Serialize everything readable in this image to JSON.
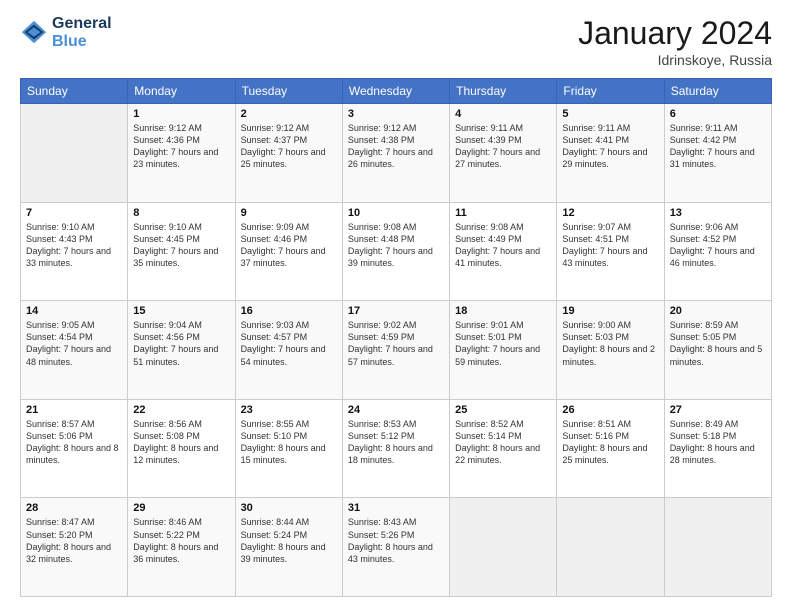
{
  "header": {
    "logo_line1": "General",
    "logo_line2": "Blue",
    "month_title": "January 2024",
    "location": "Idrinskoye, Russia"
  },
  "days_of_week": [
    "Sunday",
    "Monday",
    "Tuesday",
    "Wednesday",
    "Thursday",
    "Friday",
    "Saturday"
  ],
  "weeks": [
    [
      {
        "day": "",
        "sunrise": "",
        "sunset": "",
        "daylight": ""
      },
      {
        "day": "1",
        "sunrise": "Sunrise: 9:12 AM",
        "sunset": "Sunset: 4:36 PM",
        "daylight": "Daylight: 7 hours and 23 minutes."
      },
      {
        "day": "2",
        "sunrise": "Sunrise: 9:12 AM",
        "sunset": "Sunset: 4:37 PM",
        "daylight": "Daylight: 7 hours and 25 minutes."
      },
      {
        "day": "3",
        "sunrise": "Sunrise: 9:12 AM",
        "sunset": "Sunset: 4:38 PM",
        "daylight": "Daylight: 7 hours and 26 minutes."
      },
      {
        "day": "4",
        "sunrise": "Sunrise: 9:11 AM",
        "sunset": "Sunset: 4:39 PM",
        "daylight": "Daylight: 7 hours and 27 minutes."
      },
      {
        "day": "5",
        "sunrise": "Sunrise: 9:11 AM",
        "sunset": "Sunset: 4:41 PM",
        "daylight": "Daylight: 7 hours and 29 minutes."
      },
      {
        "day": "6",
        "sunrise": "Sunrise: 9:11 AM",
        "sunset": "Sunset: 4:42 PM",
        "daylight": "Daylight: 7 hours and 31 minutes."
      }
    ],
    [
      {
        "day": "7",
        "sunrise": "Sunrise: 9:10 AM",
        "sunset": "Sunset: 4:43 PM",
        "daylight": "Daylight: 7 hours and 33 minutes."
      },
      {
        "day": "8",
        "sunrise": "Sunrise: 9:10 AM",
        "sunset": "Sunset: 4:45 PM",
        "daylight": "Daylight: 7 hours and 35 minutes."
      },
      {
        "day": "9",
        "sunrise": "Sunrise: 9:09 AM",
        "sunset": "Sunset: 4:46 PM",
        "daylight": "Daylight: 7 hours and 37 minutes."
      },
      {
        "day": "10",
        "sunrise": "Sunrise: 9:08 AM",
        "sunset": "Sunset: 4:48 PM",
        "daylight": "Daylight: 7 hours and 39 minutes."
      },
      {
        "day": "11",
        "sunrise": "Sunrise: 9:08 AM",
        "sunset": "Sunset: 4:49 PM",
        "daylight": "Daylight: 7 hours and 41 minutes."
      },
      {
        "day": "12",
        "sunrise": "Sunrise: 9:07 AM",
        "sunset": "Sunset: 4:51 PM",
        "daylight": "Daylight: 7 hours and 43 minutes."
      },
      {
        "day": "13",
        "sunrise": "Sunrise: 9:06 AM",
        "sunset": "Sunset: 4:52 PM",
        "daylight": "Daylight: 7 hours and 46 minutes."
      }
    ],
    [
      {
        "day": "14",
        "sunrise": "Sunrise: 9:05 AM",
        "sunset": "Sunset: 4:54 PM",
        "daylight": "Daylight: 7 hours and 48 minutes."
      },
      {
        "day": "15",
        "sunrise": "Sunrise: 9:04 AM",
        "sunset": "Sunset: 4:56 PM",
        "daylight": "Daylight: 7 hours and 51 minutes."
      },
      {
        "day": "16",
        "sunrise": "Sunrise: 9:03 AM",
        "sunset": "Sunset: 4:57 PM",
        "daylight": "Daylight: 7 hours and 54 minutes."
      },
      {
        "day": "17",
        "sunrise": "Sunrise: 9:02 AM",
        "sunset": "Sunset: 4:59 PM",
        "daylight": "Daylight: 7 hours and 57 minutes."
      },
      {
        "day": "18",
        "sunrise": "Sunrise: 9:01 AM",
        "sunset": "Sunset: 5:01 PM",
        "daylight": "Daylight: 7 hours and 59 minutes."
      },
      {
        "day": "19",
        "sunrise": "Sunrise: 9:00 AM",
        "sunset": "Sunset: 5:03 PM",
        "daylight": "Daylight: 8 hours and 2 minutes."
      },
      {
        "day": "20",
        "sunrise": "Sunrise: 8:59 AM",
        "sunset": "Sunset: 5:05 PM",
        "daylight": "Daylight: 8 hours and 5 minutes."
      }
    ],
    [
      {
        "day": "21",
        "sunrise": "Sunrise: 8:57 AM",
        "sunset": "Sunset: 5:06 PM",
        "daylight": "Daylight: 8 hours and 8 minutes."
      },
      {
        "day": "22",
        "sunrise": "Sunrise: 8:56 AM",
        "sunset": "Sunset: 5:08 PM",
        "daylight": "Daylight: 8 hours and 12 minutes."
      },
      {
        "day": "23",
        "sunrise": "Sunrise: 8:55 AM",
        "sunset": "Sunset: 5:10 PM",
        "daylight": "Daylight: 8 hours and 15 minutes."
      },
      {
        "day": "24",
        "sunrise": "Sunrise: 8:53 AM",
        "sunset": "Sunset: 5:12 PM",
        "daylight": "Daylight: 8 hours and 18 minutes."
      },
      {
        "day": "25",
        "sunrise": "Sunrise: 8:52 AM",
        "sunset": "Sunset: 5:14 PM",
        "daylight": "Daylight: 8 hours and 22 minutes."
      },
      {
        "day": "26",
        "sunrise": "Sunrise: 8:51 AM",
        "sunset": "Sunset: 5:16 PM",
        "daylight": "Daylight: 8 hours and 25 minutes."
      },
      {
        "day": "27",
        "sunrise": "Sunrise: 8:49 AM",
        "sunset": "Sunset: 5:18 PM",
        "daylight": "Daylight: 8 hours and 28 minutes."
      }
    ],
    [
      {
        "day": "28",
        "sunrise": "Sunrise: 8:47 AM",
        "sunset": "Sunset: 5:20 PM",
        "daylight": "Daylight: 8 hours and 32 minutes."
      },
      {
        "day": "29",
        "sunrise": "Sunrise: 8:46 AM",
        "sunset": "Sunset: 5:22 PM",
        "daylight": "Daylight: 8 hours and 36 minutes."
      },
      {
        "day": "30",
        "sunrise": "Sunrise: 8:44 AM",
        "sunset": "Sunset: 5:24 PM",
        "daylight": "Daylight: 8 hours and 39 minutes."
      },
      {
        "day": "31",
        "sunrise": "Sunrise: 8:43 AM",
        "sunset": "Sunset: 5:26 PM",
        "daylight": "Daylight: 8 hours and 43 minutes."
      },
      {
        "day": "",
        "sunrise": "",
        "sunset": "",
        "daylight": ""
      },
      {
        "day": "",
        "sunrise": "",
        "sunset": "",
        "daylight": ""
      },
      {
        "day": "",
        "sunrise": "",
        "sunset": "",
        "daylight": ""
      }
    ]
  ]
}
